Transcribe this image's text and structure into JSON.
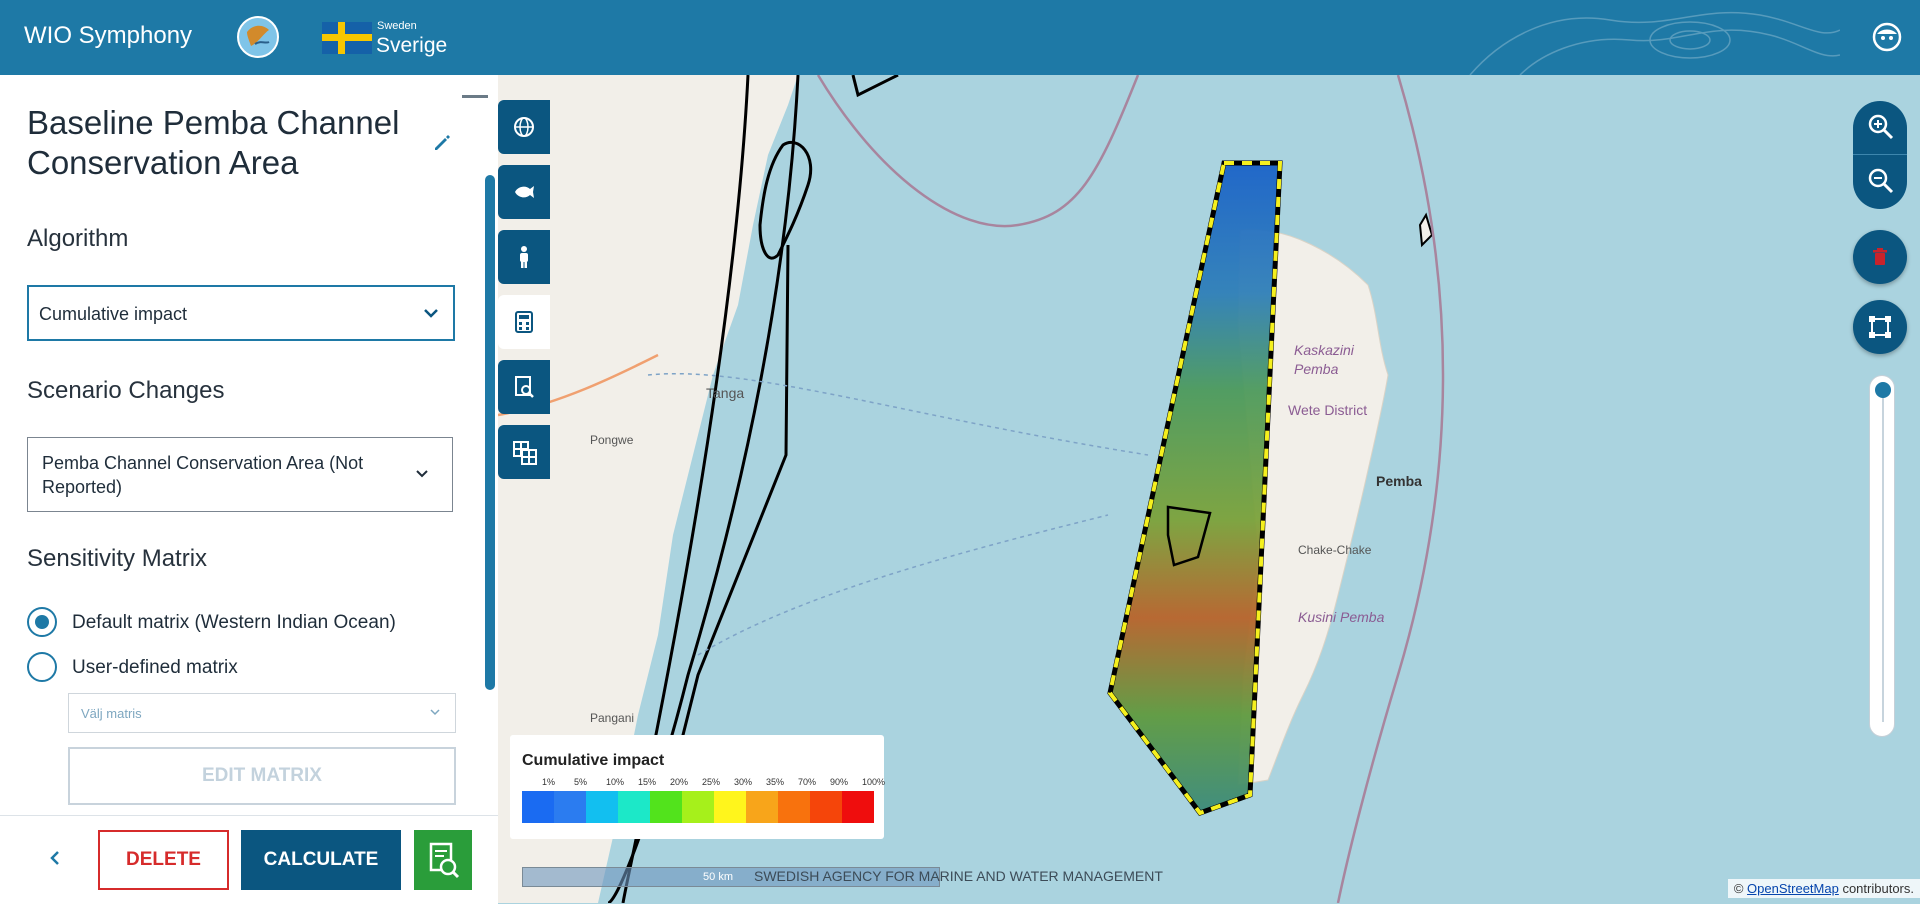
{
  "app": {
    "title": "WIO Symphony",
    "country_small": "Sweden",
    "country_big": "Sverige"
  },
  "panel": {
    "title": "Baseline Pemba Channel Conservation Area",
    "algorithm_label": "Algorithm",
    "algorithm_value": "Cumulative impact",
    "scenario_label": "Scenario Changes",
    "scenario_value": "Pemba Channel Conservation Area (Not Reported)",
    "sensitivity_label": "Sensitivity Matrix",
    "radio_default": "Default matrix (Western Indian Ocean)",
    "radio_user": "User-defined matrix",
    "matrix_placeholder": "Välj matris",
    "edit_matrix": "EDIT MATRIX",
    "delete": "DELETE",
    "calculate": "CALCULATE"
  },
  "map": {
    "tools": [
      "globe-icon",
      "fish-icon",
      "person-icon",
      "calculator-icon",
      "report-icon",
      "grid-icon"
    ],
    "active_tool": "calculator-icon",
    "places": {
      "tanga": "Tanga",
      "pongwe": "Pongwe",
      "pangani": "Pangani",
      "kaskazini": "Kaskazini Pemba",
      "wete": "Wete District",
      "pemba": "Pemba",
      "chake": "Chake-Chake",
      "kusini": "Kusini Pemba"
    },
    "legend": {
      "title": "Cumulative impact",
      "ticks": [
        "1%",
        "5%",
        "10%",
        "15%",
        "20%",
        "25%",
        "30%",
        "35%",
        "70%",
        "90%",
        "100%"
      ],
      "colors": [
        "#1a6bf2",
        "#2b7cf0",
        "#12bff0",
        "#1ce8c8",
        "#52e31c",
        "#a6f01b",
        "#fff51c",
        "#f8a51a",
        "#f8720d",
        "#f5450a",
        "#ef0d0d"
      ]
    },
    "scale_label": "50 km",
    "agency": "SWEDISH AGENCY FOR MARINE AND WATER MANAGEMENT",
    "attribution_prefix": "©",
    "attribution_link": "OpenStreetMap",
    "attribution_suffix": "contributors."
  }
}
